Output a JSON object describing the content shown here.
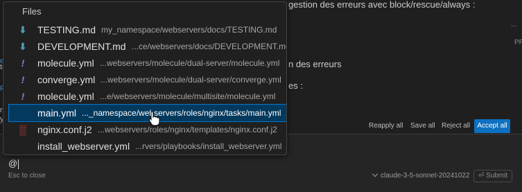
{
  "background": {
    "lines": [
      {
        "text": "gestion des erreurs avec block/rescue/always :"
      },
      {
        "text": "n des erreurs"
      },
      {
        "text": "es :"
      }
    ],
    "left_fragments": [
      "el",
      "te",
      "Pr",
      "ns",
      "yf",
      "I"
    ],
    "right_fragments": [
      "...",
      "PR"
    ]
  },
  "action_bar": {
    "reapply_label": "Reapply all",
    "save_label": "Save all",
    "reject_label": "Reject all",
    "accept_label": "Accept all",
    "accent_color": "#0e70c0"
  },
  "chat_input": {
    "value": "@",
    "esc_hint": "Esc to close",
    "model": "claude-3-5-sonnet-20241022",
    "submit_label": "Submit"
  },
  "file_popup": {
    "title": "Files",
    "items": [
      {
        "name": "TESTING.md",
        "path": "my_namespace/webservers/docs/TESTING.md",
        "icon": "markdown-arrow-icon",
        "glyph": "⬇",
        "cls": "icon-md"
      },
      {
        "name": "DEVELOPMENT.md",
        "path": "...ce/webservers/docs/DEVELOPMENT.md",
        "icon": "markdown-arrow-icon",
        "glyph": "⬇",
        "cls": "icon-md"
      },
      {
        "name": "molecule.yml",
        "path": "...webservers/molecule/dual-server/molecule.yml",
        "icon": "yaml-icon",
        "glyph": "!",
        "cls": "icon-yml"
      },
      {
        "name": "converge.yml",
        "path": "...webservers/molecule/dual-server/converge.yml",
        "icon": "yaml-icon",
        "glyph": "!",
        "cls": "icon-yml"
      },
      {
        "name": "molecule.yml",
        "path": "...e/webservers/molecule/multisite/molecule.yml",
        "icon": "yaml-icon",
        "glyph": "!",
        "cls": "icon-yml"
      },
      {
        "name": "main.yml",
        "path": "..._namespace/webservers/roles/nginx/tasks/main.yml",
        "icon": "yaml-icon",
        "glyph": "",
        "cls": "icon-yml",
        "selected": true
      },
      {
        "name": "nginx.conf.j2",
        "path": "...webservers/roles/nginx/templates/nginx.conf.j2",
        "icon": "jinja-icon",
        "glyph": "▒",
        "cls": "icon-nginx"
      },
      {
        "name": "install_webserver.yml",
        "path": "...rvers/playbooks/install_webserver.yml",
        "icon": "yaml-icon",
        "glyph": "",
        "cls": "icon-yml"
      }
    ]
  }
}
